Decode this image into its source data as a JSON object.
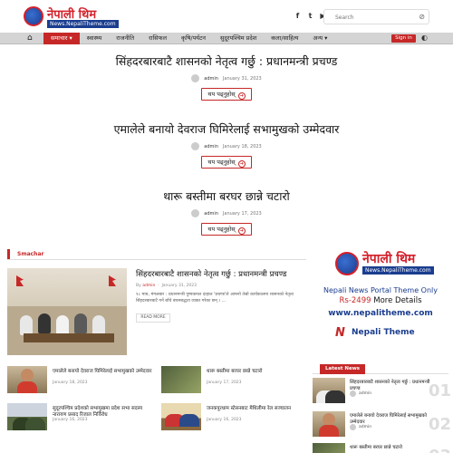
{
  "header": {
    "logo_name": "नेपाली थिम",
    "logo_url": "News.NepaliTheme.com",
    "socials": [
      "f",
      "t",
      "▶"
    ],
    "search_placeholder": "Search",
    "search_icon": "search-icon"
  },
  "nav": {
    "home_icon": "⌂",
    "items": [
      "समाचार ▾",
      "स्वास्थ्य",
      "राजनीति",
      "रासिफल",
      "कृषि/पर्यटन",
      "सुदूरपश्चिम प्रदेश",
      "कला/साहित्य",
      "अन्य ▾"
    ],
    "signin_label": "Sign in",
    "toggle_icon": "◐"
  },
  "featured": [
    {
      "title": "सिंहदरबारबाटै शासनको नेतृत्व गर्छु : प्रधानमन्त्री प्रचण्ड",
      "author": "admin",
      "date": "January 31, 2023",
      "more": "थप पढ्नुहोस्"
    },
    {
      "title": "एमालेले बनायो देवराज घिमिरेलाई सभामुखको उम्मेदवार",
      "author": "admin",
      "date": "January 18, 2023",
      "more": "थप पढ्नुहोस्"
    },
    {
      "title": "थारू बस्तीमा बरघर छान्ने चटारो",
      "author": "admin",
      "date": "January 17, 2023",
      "more": "थप पढ्नुहोस्"
    }
  ],
  "samachar": {
    "section_label": "Smachar",
    "main": {
      "title": "सिंहदरबारबाटै शासनको नेतृत्व गर्छु : प्रधानमन्त्री प्रचण्ड",
      "by": "By",
      "author": "admin",
      "date": "January 31, 2023",
      "excerpt": "१८ माघ, मंगलबार : प्रधानमन्त्री पुष्पकमल दाहाल 'प्रचण्ड'ले आफ्नो तेस्रो कार्यकालमा शासनको नेतृत्व सिंहदरबारबाटै गर्ने बाँचे बचनबद्धता व्यक्त गरेका छन् । ...",
      "read_more": "READ MORE"
    },
    "small": [
      {
        "title": "एमालेले बनायो देवराज घिमिरेलाई सभामुखको उम्मेदवार",
        "date": "January 18, 2023"
      },
      {
        "title": "थारू बस्तीमा बरघर छान्ने चटारो",
        "date": "January 17, 2023"
      },
      {
        "title": "सुदूरपश्चिम प्रदेशको सभामुखमा प्रदेश सभा सदस्य नारायण प्रसाद रिजाल निर्विरोध",
        "date": "January 16, 2023"
      },
      {
        "title": "जनकपुरधाम स्टेसनबाट मैथिलीमा रेल सञ्चालन",
        "date": "January 16, 2023"
      }
    ]
  },
  "ad": {
    "logo_name": "नेपाली थिम",
    "logo_url": "News.NepaliTheme.com",
    "line1": "Nepali News Portal Theme Only",
    "price": "Rs-2499",
    "details": "More Details",
    "site": "www.nepalitheme.com",
    "brand_mark": "N",
    "brand_text": "Nepali Theme"
  },
  "latest": {
    "label": "Latest News",
    "items": [
      {
        "title": "सिंहदरबारबाटै शासनको नेतृत्व गर्छु : प्रधानमन्त्री प्रचण्ड",
        "author": "admin",
        "num": "01"
      },
      {
        "title": "एमालेले बनायो देवराज घिमिरेलाई सभामुखको उम्मेदवार",
        "author": "admin",
        "num": "02"
      },
      {
        "title": "थारू बस्तीमा बरघर छान्ने चटारो",
        "author": "admin",
        "num": "03"
      }
    ]
  },
  "colors": {
    "brand_red": "#c62828",
    "brand_blue": "#1a3d8f",
    "nav_bg": "#d4d4d4"
  }
}
